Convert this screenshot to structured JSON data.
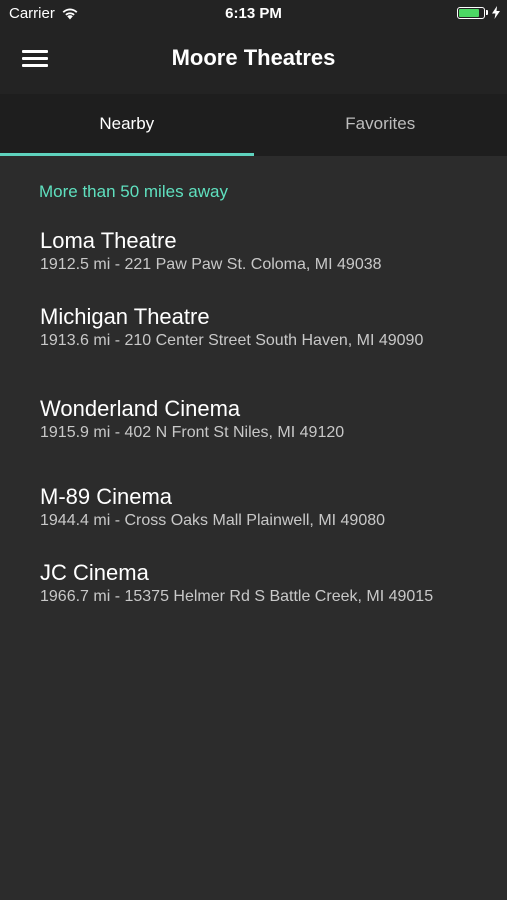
{
  "status": {
    "carrier": "Carrier",
    "time": "6:13 PM"
  },
  "nav": {
    "title": "Moore Theatres"
  },
  "tabs": [
    {
      "label": "Nearby",
      "active": true
    },
    {
      "label": "Favorites",
      "active": false
    }
  ],
  "section": {
    "header": "More than 50 miles away"
  },
  "theatres": [
    {
      "name": "Loma Theatre",
      "detail": "1912.5 mi - 221 Paw Paw St. Coloma, MI 49038"
    },
    {
      "name": "Michigan Theatre",
      "detail": "1913.6 mi - 210 Center Street South Haven, MI 49090"
    },
    {
      "name": "Wonderland Cinema",
      "detail": "1915.9 mi - 402 N Front St Niles, MI 49120"
    },
    {
      "name": "M-89 Cinema",
      "detail": "1944.4 mi - Cross Oaks Mall Plainwell, MI 49080"
    },
    {
      "name": "JC Cinema",
      "detail": "1966.7 mi - 15375 Helmer Rd S Battle Creek, MI 49015"
    }
  ],
  "colors": {
    "accent": "#5fd3be",
    "section_header": "#5fe0bf",
    "battery": "#4cd964"
  },
  "battery_level": 0.85
}
